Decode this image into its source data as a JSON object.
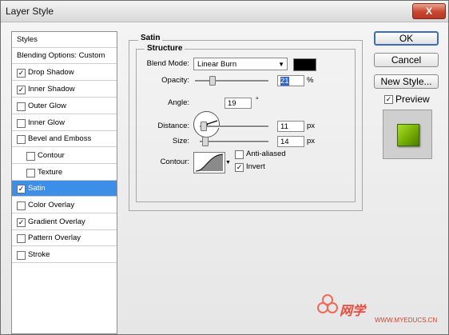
{
  "window": {
    "title": "Layer Style",
    "close_label": "X"
  },
  "styles_panel": {
    "items": [
      {
        "label": "Styles",
        "checkbox": false,
        "checked": false
      },
      {
        "label": "Blending Options: Custom",
        "checkbox": false,
        "checked": false
      },
      {
        "label": "Drop Shadow",
        "checkbox": true,
        "checked": true
      },
      {
        "label": "Inner Shadow",
        "checkbox": true,
        "checked": true
      },
      {
        "label": "Outer Glow",
        "checkbox": true,
        "checked": false
      },
      {
        "label": "Inner Glow",
        "checkbox": true,
        "checked": false
      },
      {
        "label": "Bevel and Emboss",
        "checkbox": true,
        "checked": false
      },
      {
        "label": "Contour",
        "checkbox": true,
        "checked": false
      },
      {
        "label": "Texture",
        "checkbox": true,
        "checked": false
      },
      {
        "label": "Satin",
        "checkbox": true,
        "checked": true,
        "selected": true
      },
      {
        "label": "Color Overlay",
        "checkbox": true,
        "checked": false
      },
      {
        "label": "Gradient Overlay",
        "checkbox": true,
        "checked": true
      },
      {
        "label": "Pattern Overlay",
        "checkbox": true,
        "checked": false
      },
      {
        "label": "Stroke",
        "checkbox": true,
        "checked": false
      }
    ]
  },
  "satin": {
    "group_title": "Satin",
    "structure_title": "Structure",
    "blend_mode_label": "Blend Mode:",
    "blend_mode_value": "Linear Burn",
    "blend_color": "#000000",
    "opacity_label": "Opacity:",
    "opacity_value": "21",
    "opacity_unit": "%",
    "angle_label": "Angle:",
    "angle_value": "19",
    "angle_unit": "°",
    "distance_label": "Distance:",
    "distance_value": "11",
    "distance_unit": "px",
    "size_label": "Size:",
    "size_value": "14",
    "size_unit": "px",
    "contour_label": "Contour:",
    "anti_aliased_label": "Anti-aliased",
    "anti_aliased_checked": false,
    "invert_label": "Invert",
    "invert_checked": true
  },
  "buttons": {
    "ok": "OK",
    "cancel": "Cancel",
    "new_style": "New Style...",
    "preview_label": "Preview",
    "preview_checked": true
  },
  "watermark": {
    "text": "网学",
    "url": "WWW.MYEDUCS.CN"
  },
  "colors": {
    "selection": "#3d8ee6",
    "preview_green": "#8cc400",
    "default_border": "#3a6fb7"
  }
}
